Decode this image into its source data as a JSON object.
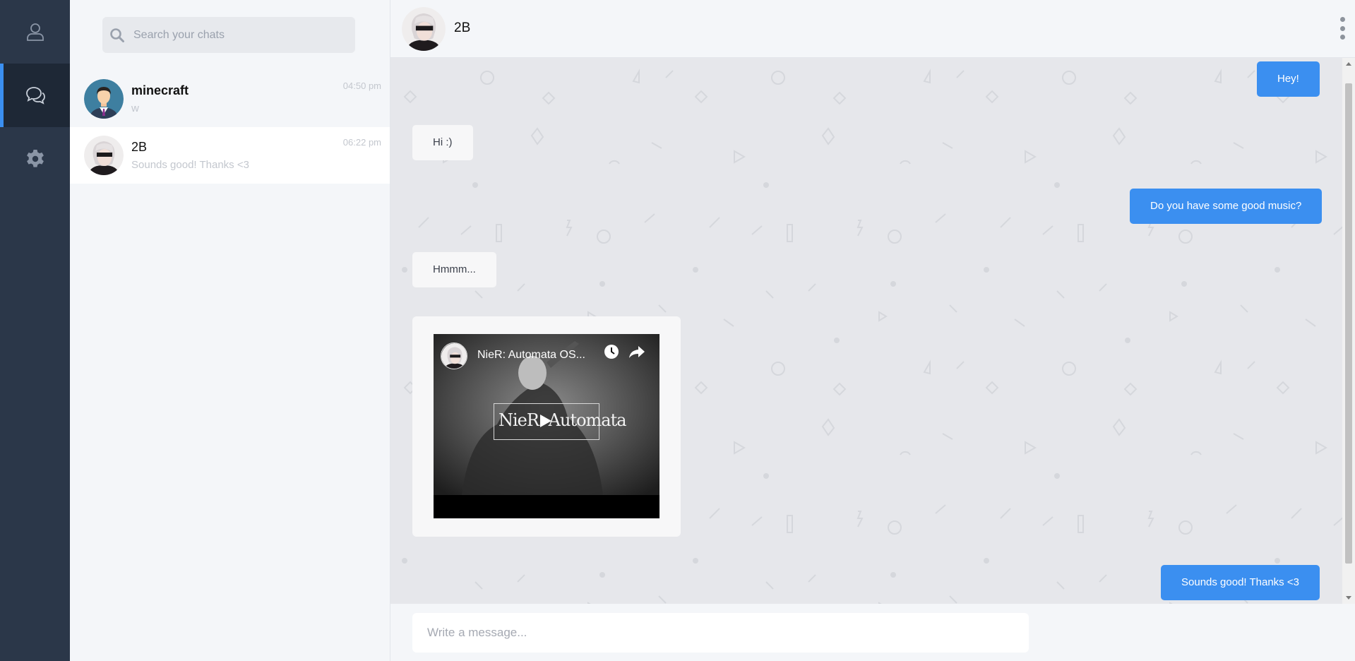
{
  "nav": {
    "items": [
      {
        "icon": "user-icon",
        "active": false
      },
      {
        "icon": "chat-bubbles-icon",
        "active": true
      },
      {
        "icon": "gear-icon",
        "active": false
      }
    ]
  },
  "search": {
    "placeholder": "Search your chats",
    "value": ""
  },
  "chats": [
    {
      "name": "minecraft",
      "preview": "w",
      "time": "04:50 pm",
      "selected": false
    },
    {
      "name": "2B",
      "preview": "Sounds good! Thanks <3",
      "time": "06:22 pm",
      "selected": true
    }
  ],
  "conversation": {
    "title": "2B",
    "messages": [
      {
        "direction": "out",
        "text": "Hey!"
      },
      {
        "direction": "in",
        "text": "Hi :)"
      },
      {
        "direction": "out",
        "text": "Do you have some good music?"
      },
      {
        "direction": "in",
        "text": "Hmmm..."
      },
      {
        "direction": "in",
        "type": "video",
        "video_title": "NieR: Automata OS...",
        "video_logo_text": "NieR: Automata"
      },
      {
        "direction": "out",
        "text": "Sounds good! Thanks <3"
      }
    ]
  },
  "composer": {
    "placeholder": "Write a message...",
    "value": ""
  },
  "colors": {
    "rail": "#2b3749",
    "accent": "#3b8ff0",
    "outgoing_bubble": "#3b8ff0",
    "incoming_bubble": "#f7f7f8",
    "conversation_bg": "#e6e7eb"
  }
}
